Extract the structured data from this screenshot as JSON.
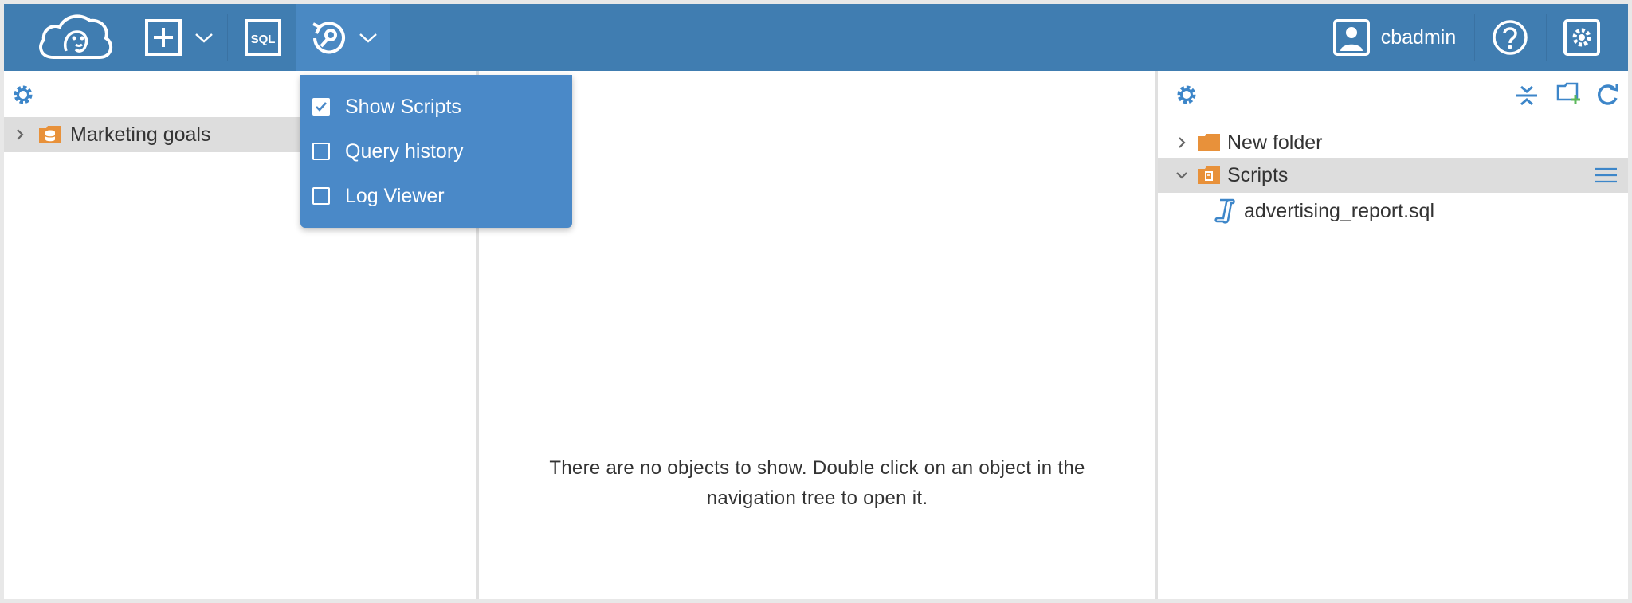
{
  "toolbar": {
    "user_name": "cbadmin",
    "sql_label": "SQL"
  },
  "tools_menu": {
    "items": [
      {
        "label": "Show Scripts",
        "checked": true
      },
      {
        "label": "Query history",
        "checked": false
      },
      {
        "label": "Log Viewer",
        "checked": false
      }
    ]
  },
  "left_panel": {
    "tree": [
      {
        "label": "Marketing goals",
        "icon": "database-folder-icon",
        "expanded": false
      }
    ]
  },
  "center_panel": {
    "empty_message_line1": "There are no objects to show. Double click on an object in the",
    "empty_message_line2": "navigation tree to open it."
  },
  "right_panel": {
    "tree": [
      {
        "label": "New folder",
        "icon": "folder-icon",
        "expanded": false
      },
      {
        "label": "Scripts",
        "icon": "scripts-folder-icon",
        "expanded": true
      },
      {
        "label": "advertising_report.sql",
        "icon": "script-file-icon"
      }
    ]
  },
  "colors": {
    "topbar": "#407db1",
    "dropdown": "#4a89c8",
    "accent_icon": "#3d86c9",
    "folder_orange": "#e8913a"
  }
}
